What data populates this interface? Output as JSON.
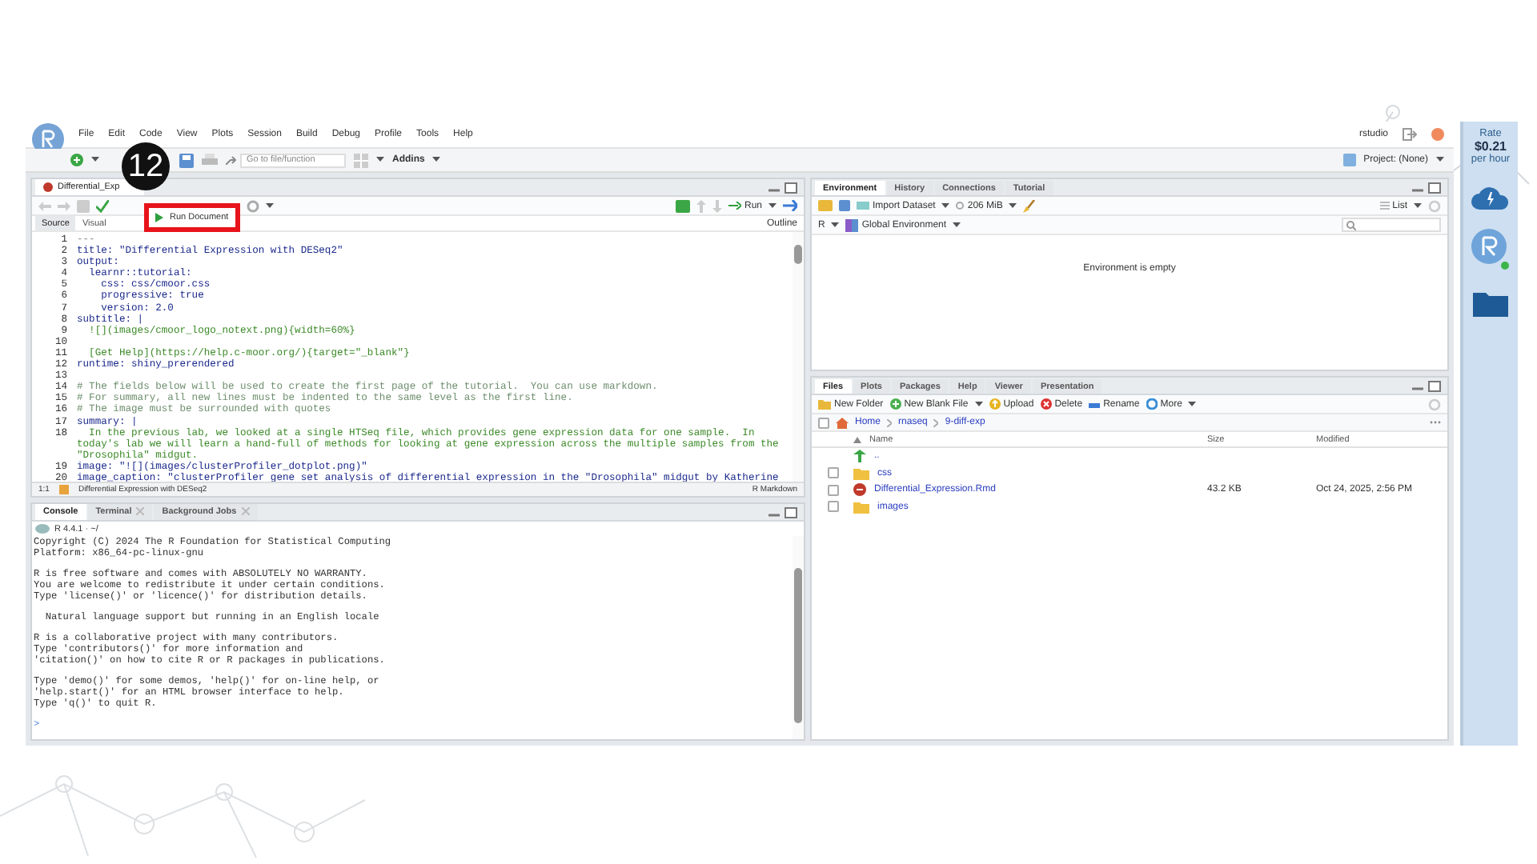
{
  "annotation": {
    "step": "12"
  },
  "menu": [
    "File",
    "Edit",
    "Code",
    "View",
    "Plots",
    "Session",
    "Build",
    "Debug",
    "Profile",
    "Tools",
    "Help"
  ],
  "user": "rstudio",
  "toolbar": {
    "goto_placeholder": "Go to file/function",
    "addins": "Addins"
  },
  "project": "Project: (None)",
  "source": {
    "tab": "Differential_Exp",
    "run_document": "Run Document",
    "run": "Run",
    "outline": "Outline",
    "modes": [
      {
        "label": "Source",
        "selected": true
      },
      {
        "label": "Visual",
        "selected": false
      }
    ],
    "lines": [
      {
        "n": "1",
        "text": "---",
        "kind": "meta"
      },
      {
        "n": "2",
        "text": "title: \"Differential Expression with DESeq2\"",
        "kind": "key"
      },
      {
        "n": "3",
        "text": "output:",
        "kind": "key"
      },
      {
        "n": "4",
        "text": "  learnr::tutorial:",
        "kind": "key"
      },
      {
        "n": "5",
        "text": "    css: css/cmoor.css",
        "kind": "key"
      },
      {
        "n": "6",
        "text": "    progressive: true",
        "kind": "key"
      },
      {
        "n": "7",
        "text": "    version: 2.0",
        "kind": "key"
      },
      {
        "n": "8",
        "text": "subtitle: |",
        "kind": "key"
      },
      {
        "n": "9",
        "text": "  ![](images/cmoor_logo_notext.png){width=60%}",
        "kind": "string"
      },
      {
        "n": "10"
      },
      {
        "n": "11",
        "text": "  [Get Help](https://help.c-moor.org/){target=\"_blank\"}",
        "kind": "string"
      },
      {
        "n": "12",
        "text": "runtime: shiny_prerendered",
        "kind": "key"
      },
      {
        "n": "13"
      },
      {
        "n": "14",
        "text": "# The fields below will be used to create the first page of the tutorial.  You can use markdown.",
        "kind": "comment"
      },
      {
        "n": "15",
        "text": "# For summary, all new lines must be indented to the same level as the first line.",
        "kind": "comment"
      },
      {
        "n": "16",
        "text": "# The image must be surrounded with quotes",
        "kind": "comment"
      },
      {
        "n": "17",
        "text": "summary: |",
        "kind": "key"
      },
      {
        "n": "18",
        "text": "  In the previous lab, we looked at a single HTSeq file, which provides gene expression data for one sample.  In",
        "wrap": [
          "today's lab we will learn a hand-full of methods for looking at gene expression across the multiple samples from the",
          "\"Drosophila\" midgut."
        ],
        "kind": "string"
      },
      {
        "n": "19",
        "text": "image: \"![](images/clusterProfiler_dotplot.png)\"",
        "kind": "key"
      },
      {
        "n": "20",
        "text": "image_caption: \"clusterProfiler gene set analysis of differential expression in the \"Drosophila\" midgut by Katherine",
        "kind": "key"
      }
    ],
    "status": {
      "position": "1:1",
      "section": "Differential Expression with DESeq2",
      "mode": "R Markdown"
    }
  },
  "console": {
    "tabs": [
      {
        "label": "Console",
        "selected": true,
        "closable": false
      },
      {
        "label": "Terminal",
        "selected": false,
        "closable": true
      },
      {
        "label": "Background Jobs",
        "selected": false,
        "closable": true
      }
    ],
    "version": "R 4.4.1 · ~/",
    "paragraphs": [
      [
        "Copyright (C) 2024 The R Foundation for Statistical Computing",
        "Platform: x86_64-pc-linux-gnu"
      ],
      [
        "R is free software and comes with ABSOLUTELY NO WARRANTY.",
        "You are welcome to redistribute it under certain conditions.",
        "Type 'license()' or 'licence()' for distribution details."
      ],
      [
        "  Natural language support but running in an English locale"
      ],
      [
        "R is a collaborative project with many contributors.",
        "Type 'contributors()' for more information and",
        "'citation()' on how to cite R or R packages in publications."
      ],
      [
        "Type 'demo()' for some demos, 'help()' for on-line help, or",
        "'help.start()' for an HTML browser interface to help.",
        "Type 'q()' to quit R."
      ]
    ],
    "prompt": ">"
  },
  "environment": {
    "tabs": [
      {
        "label": "Environment",
        "selected": true
      },
      {
        "label": "History",
        "selected": false
      },
      {
        "label": "Connections",
        "selected": false
      },
      {
        "label": "Tutorial",
        "selected": false
      }
    ],
    "import": "Import Dataset",
    "memory": "206 MiB",
    "view": "List",
    "language": "R",
    "scope": "Global Environment",
    "empty": "Environment is empty"
  },
  "files": {
    "tabs": [
      {
        "label": "Files",
        "selected": true
      },
      {
        "label": "Plots",
        "selected": false
      },
      {
        "label": "Packages",
        "selected": false
      },
      {
        "label": "Help",
        "selected": false
      },
      {
        "label": "Viewer",
        "selected": false
      },
      {
        "label": "Presentation",
        "selected": false
      }
    ],
    "actions": [
      {
        "label": "New Folder",
        "kind": "folder"
      },
      {
        "label": "New Blank File",
        "kind": "file"
      },
      {
        "label": "Upload",
        "kind": "upload"
      },
      {
        "label": "Delete",
        "kind": "delete"
      },
      {
        "label": "Rename",
        "kind": "rename"
      },
      {
        "label": "More",
        "kind": "more"
      }
    ],
    "all_checked": false,
    "path": [
      "Home",
      "rnaseq",
      "9-diff-exp"
    ],
    "columns": [
      "Name",
      "Size",
      "Modified"
    ],
    "rows": [
      {
        "kind": "up",
        "name": ".."
      },
      {
        "kind": "folder",
        "name": "css",
        "checked": false
      },
      {
        "kind": "rmd",
        "name": "Differential_Expression.Rmd",
        "size": "43.2 KB",
        "modified": "Oct 24, 2025, 2:56 PM",
        "checked": false
      },
      {
        "kind": "folder",
        "name": "images",
        "checked": false
      }
    ]
  },
  "sidebar": {
    "rate_label": "Rate",
    "rate": "$0.21",
    "rate_unit": "per hour"
  }
}
